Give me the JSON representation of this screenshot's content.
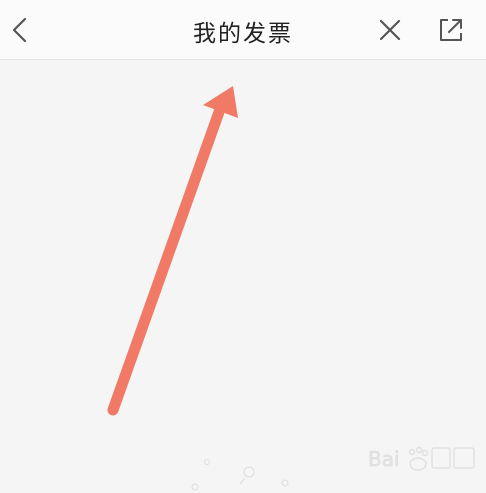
{
  "header": {
    "title": "我的发票",
    "back_icon": "chevron-left-icon",
    "close_icon": "close-icon",
    "share_icon": "share-external-icon"
  },
  "annotation": {
    "arrow_color": "#f07a66"
  },
  "colors": {
    "background": "#f5f5f5",
    "navbar": "#fbfbfb",
    "icon": "#555555"
  }
}
